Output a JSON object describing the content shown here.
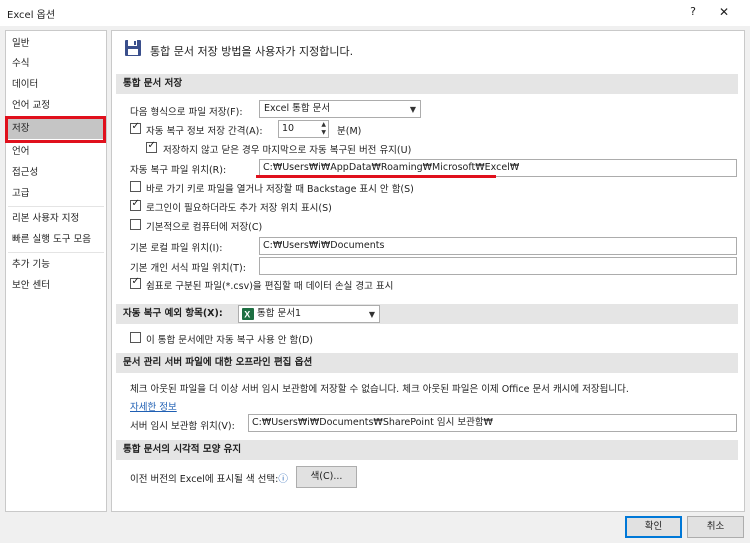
{
  "window": {
    "title": "Excel 옵션",
    "help": "?",
    "close": "✕"
  },
  "sidebar": {
    "items": [
      {
        "label": "일반"
      },
      {
        "label": "수식"
      },
      {
        "label": "데이터"
      },
      {
        "label": "언어 교정"
      },
      {
        "label": "저장",
        "selected": true
      },
      {
        "label": "언어"
      },
      {
        "label": "접근성"
      },
      {
        "label": "고급"
      },
      {
        "label": "리본 사용자 지정"
      },
      {
        "label": "빠른 실행 도구 모음"
      },
      {
        "label": "추가 기능"
      },
      {
        "label": "보안 센터"
      }
    ]
  },
  "content": {
    "header": "통합 문서 저장 방법을 사용자가 지정합니다.",
    "save_section": {
      "title": "통합 문서 저장",
      "format_label": "다음 형식으로 파일 저장(F):",
      "format_value": "Excel 통합 문서",
      "autorecover_label": "자동 복구 정보 저장 간격(A):",
      "autorecover_minutes": "10",
      "minutes_unit": "분(M)",
      "keep_last_label": "저장하지 않고 닫은 경우 마지막으로 자동 복구된 버전 유지(U)",
      "autorecover_location_label": "자동 복구 파일 위치(R):",
      "autorecover_location_value": "C:₩Users₩i₩AppData₩Roaming₩Microsoft₩Excel₩",
      "backstage_label": "바로 가기 키로 파일을 열거나 저장할 때 Backstage 표시 안 함(S)",
      "more_locations_label": "로그인이 필요하더라도 추가 저장 위치 표시(S)",
      "default_computer_label": "기본적으로 컴퓨터에 저장(C)",
      "default_local_label": "기본 로컬 파일 위치(I):",
      "default_local_value": "C:₩Users₩i₩Documents",
      "personal_template_label": "기본 개인 서식 파일 위치(T):",
      "personal_template_value": "",
      "csv_warning_label": "쉼표로 구분된 파일(*.csv)을 편집할 때 데이터 손실 경고 표시"
    },
    "autorecover_exceptions": {
      "title": "자동 복구 예외 항목(X):",
      "workbook_value": "통합 문서1",
      "disable_label": "이 통합 문서에만 자동 복구 사용 안 함(D)"
    },
    "offline_section": {
      "title": "문서 관리 서버 파일에 대한 오프라인 편집 옵션",
      "description": "체크 아웃된 파일을 더 이상 서버 임시 보관함에 저장할 수 없습니다. 체크 아웃된 파일은 이제 Office 문서 캐시에 저장됩니다.",
      "learn_more": "자세한 정보",
      "drafts_label": "서버 임시 보관함 위치(V):",
      "drafts_value": "C:₩Users₩i₩Documents₩SharePoint 임시 보관함₩"
    },
    "visual_section": {
      "title": "통합 문서의 시각적 모양 유지",
      "colors_label": "이전 버전의 Excel에 표시될 색 선택:",
      "info_icon": "ⓘ",
      "colors_button": "색(C)..."
    }
  },
  "footer": {
    "ok": "확인",
    "cancel": "취소"
  },
  "colors": {
    "highlight_red": "#e0101c",
    "selected_bg": "#c5c5c5",
    "excel_green": "#1d6f42"
  }
}
